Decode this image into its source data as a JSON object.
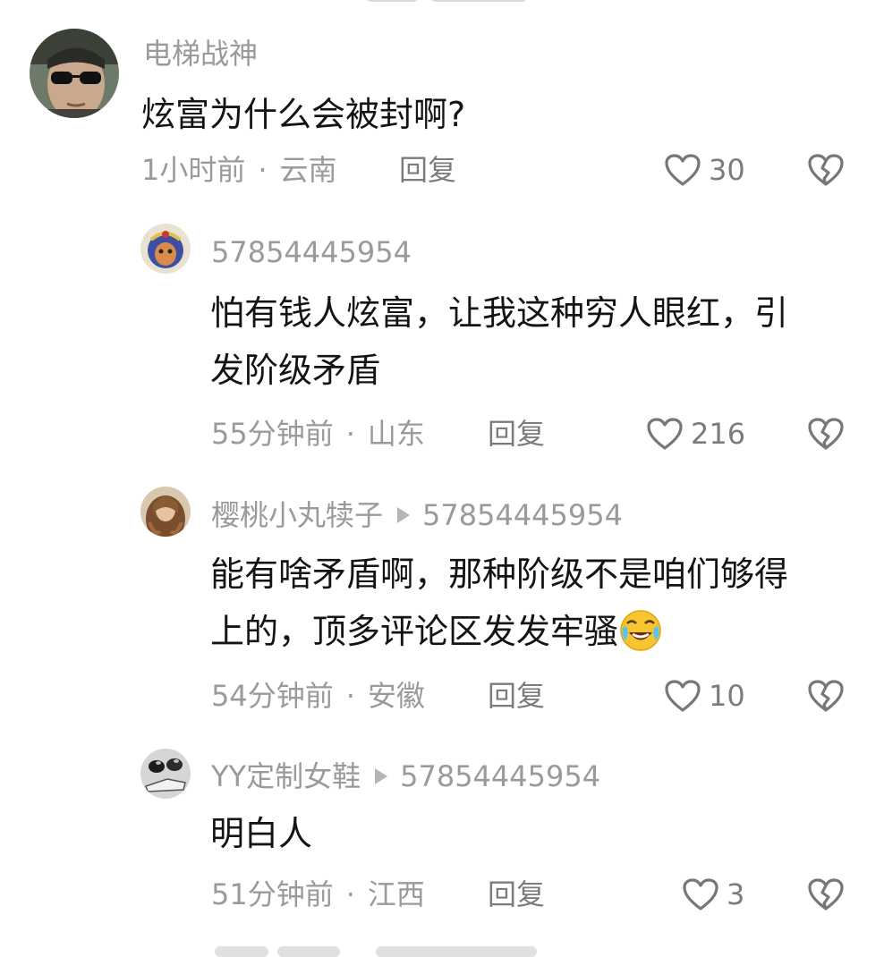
{
  "comments": [
    {
      "username": "电梯战神",
      "content_lines": [
        "炫富为什么会被封啊?"
      ],
      "time": "1小时前",
      "location": "云南",
      "reply_label": "回复",
      "likes": "30",
      "avatar_icon": "man-sunglasses-avatar"
    },
    {
      "username": "57854445954",
      "content_lines": [
        "怕有钱人炫富，让我这种穷人眼红，引",
        "发阶级矛盾"
      ],
      "time": "55分钟前",
      "location": "山东",
      "reply_label": "回复",
      "likes": "216",
      "avatar_icon": "blue-cartoon-avatar"
    },
    {
      "username": "樱桃小丸犊子",
      "reply_to": "57854445954",
      "content_lines": [
        "能有啥矛盾啊，那种阶级不是咱们够得",
        "上的，顶多评论区发发牢骚"
      ],
      "emoji": "crying-laughing-emoji",
      "time": "54分钟前",
      "location": "安徽",
      "reply_label": "回复",
      "likes": "10",
      "avatar_icon": "long-hair-avatar"
    },
    {
      "username": "YY定制女鞋",
      "reply_to": "57854445954",
      "content_lines": [
        "明白人"
      ],
      "time": "51分钟前",
      "location": "江西",
      "reply_label": "回复",
      "likes": "3",
      "avatar_icon": "shoes-avatar"
    }
  ],
  "colors": {
    "meta_text": "#9a9a9a",
    "action_text": "#7c7c7c",
    "content_text": "#141414"
  }
}
